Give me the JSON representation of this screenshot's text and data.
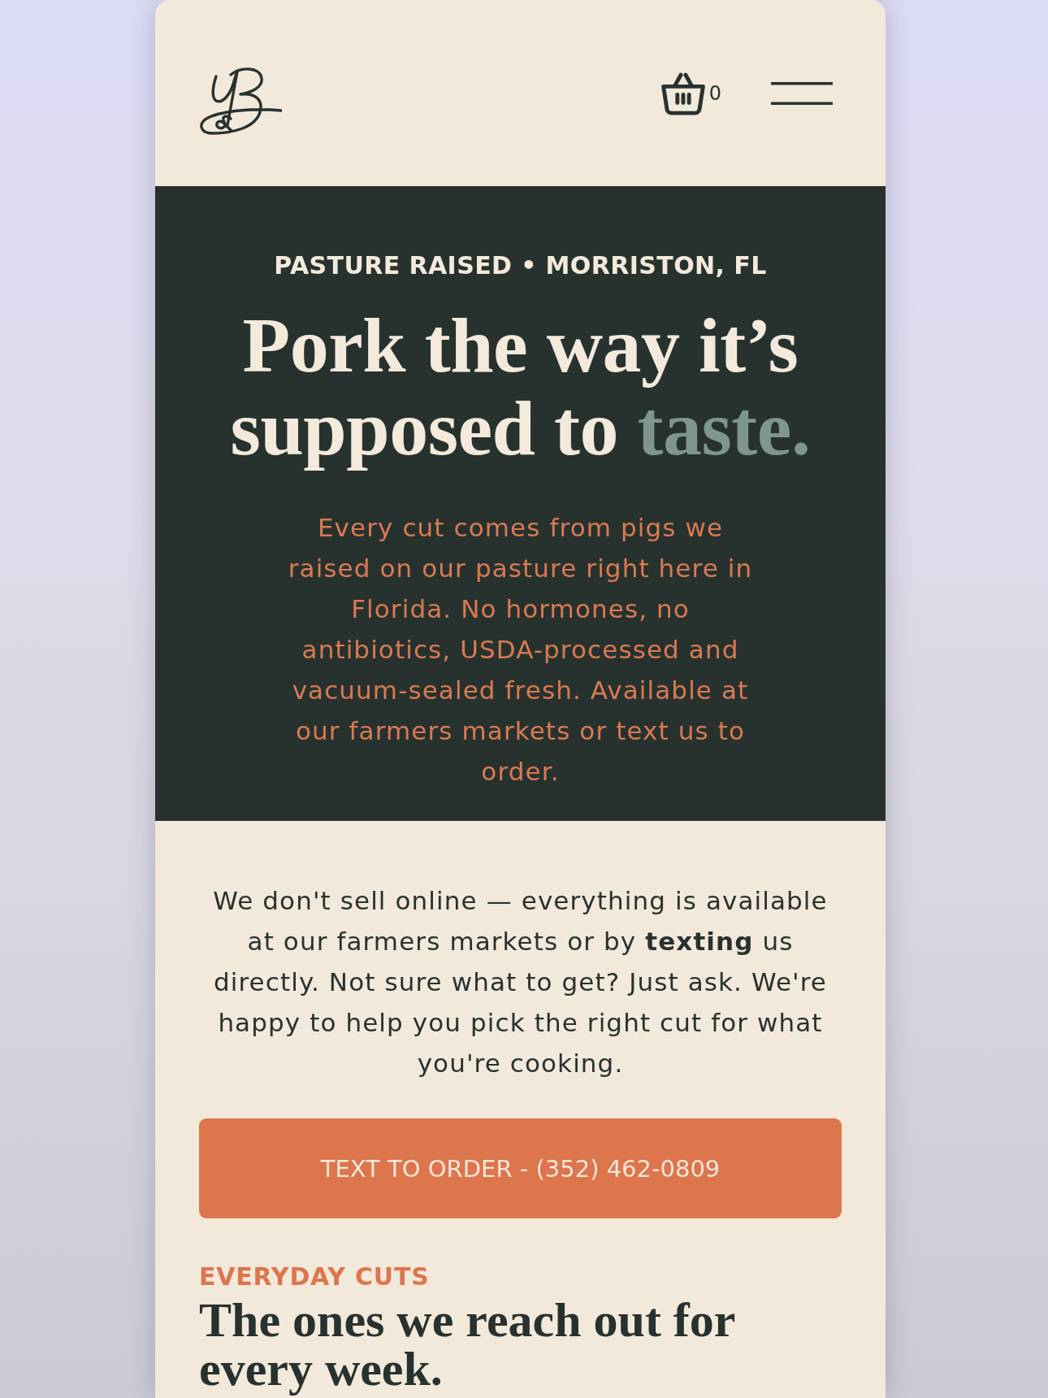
{
  "header": {
    "cart_count": "0"
  },
  "hero": {
    "eyebrow": "PASTURE RAISED • MORRISTON, FL",
    "headline": "Pork the way it’s supposed to",
    "headline_highlight": "taste.",
    "description": "Every cut comes from pigs we raised on our pasture right here in Florida. No hormones, no antibiotics, USDA-processed and vacuum-sealed fresh. Available at our farmers markets or text us to order."
  },
  "intro": {
    "text": "We don't sell online — everything is available at our farmers markets or by **texting** us directly. Not sure what to get? Just ask. We're happy to help you pick the right cut for what you're cooking."
  },
  "cta_button": {
    "label": "TEXT TO ORDER - (352) 462-0809"
  },
  "section": {
    "eyebrow": "EVERYDAY CUTS",
    "title": "The ones we reach out for every week."
  }
}
